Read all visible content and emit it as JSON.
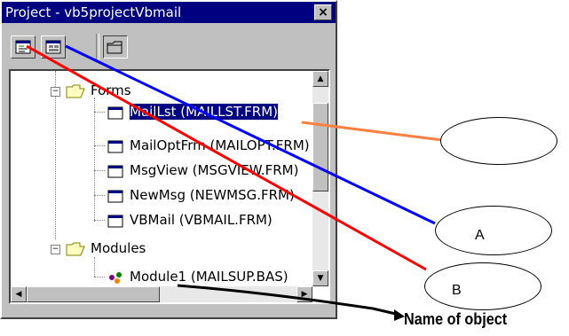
{
  "window": {
    "title": "Project - vb5projectVbmail",
    "close_glyph": "×"
  },
  "toolbar": {
    "buttons": [
      {
        "name": "view-code-button",
        "icon": "code-window-icon"
      },
      {
        "name": "view-object-button",
        "icon": "form-window-icon"
      },
      {
        "name": "toggle-folders-button",
        "icon": "folder-icon"
      }
    ]
  },
  "tree": {
    "forms_label": "Forms",
    "forms": [
      {
        "label": "MailLst (MAILLST.FRM)"
      },
      {
        "label": "MailOptFrm (MAILOPT.FRM)"
      },
      {
        "label": "MsgView (MSGVIEW.FRM)"
      },
      {
        "label": "NewMsg (NEWMSG.FRM)"
      },
      {
        "label": "VBMail (VBMAIL.FRM)"
      }
    ],
    "modules_label": "Modules",
    "modules": [
      {
        "label": "Module1 (MAILSUP.BAS)"
      }
    ]
  },
  "annotations": {
    "label_a": "A",
    "label_b": "B",
    "caption": "Name of object",
    "colors": {
      "orange": "#ff8040",
      "blue": "#0000ff",
      "red": "#ff0000",
      "black": "#000000"
    }
  }
}
